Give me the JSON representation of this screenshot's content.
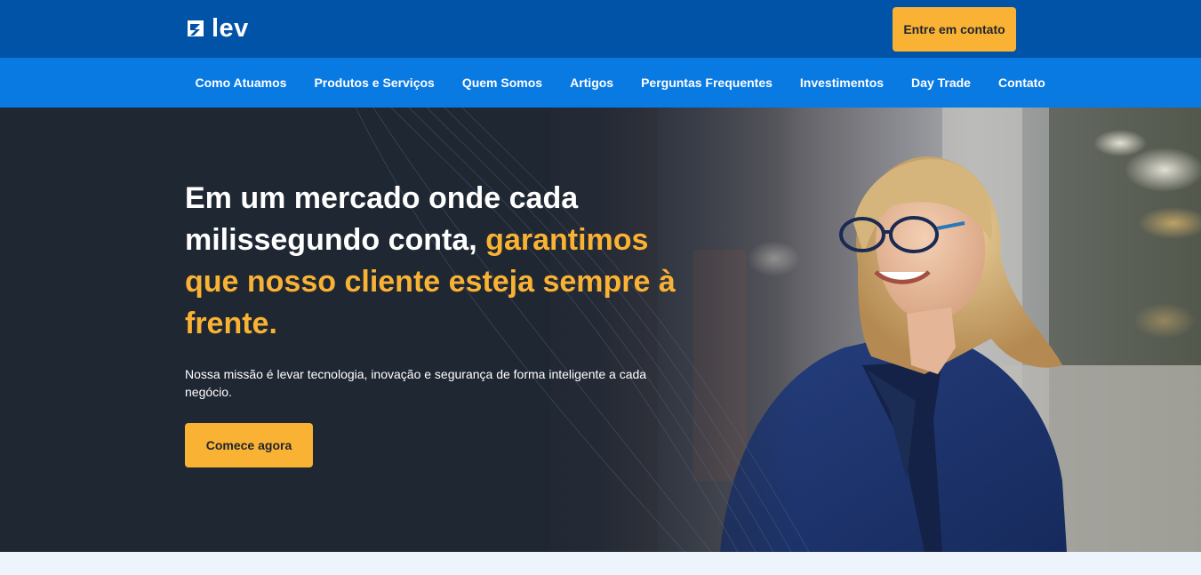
{
  "header": {
    "logo_text": "lev",
    "logo_icon": "lev-logo-icon",
    "contact_button": "Entre em contato"
  },
  "nav": {
    "items": [
      {
        "label": "Como Atuamos"
      },
      {
        "label": "Produtos e Serviços"
      },
      {
        "label": "Quem Somos"
      },
      {
        "label": "Artigos"
      },
      {
        "label": "Perguntas Frequentes"
      },
      {
        "label": "Investimentos"
      },
      {
        "label": "Day Trade"
      },
      {
        "label": "Contato"
      }
    ]
  },
  "hero": {
    "headline_white": "Em um mercado onde cada milissegundo conta, ",
    "headline_accent": "garantimos que nosso cliente esteja sempre à frente.",
    "mission": "Nossa missão é levar tecnologia, inovação e segurança de forma inteligente a cada negócio.",
    "cta": "Comece agora"
  },
  "colors": {
    "topbar": "#0053a6",
    "navbar": "#0a7ae3",
    "accent": "#f9b233",
    "hero_bg": "#1f2733",
    "page_bg": "#eef4fb"
  }
}
